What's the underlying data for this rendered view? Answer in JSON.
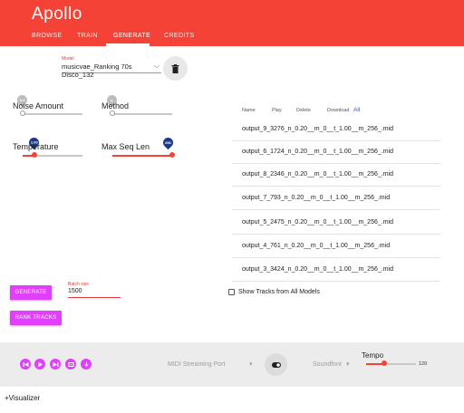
{
  "app": {
    "title": "Apollo"
  },
  "tabs": [
    {
      "label": "BROWSE"
    },
    {
      "label": "TRAIN"
    },
    {
      "label": "GENERATE"
    },
    {
      "label": "CREDITS"
    }
  ],
  "model": {
    "label": "Model",
    "value": "musicvae_Ranking 70s Disco_132"
  },
  "params": {
    "noise_amount": {
      "label": "Noise Amount",
      "value": "0.2"
    },
    "method": {
      "label": "Method",
      "value": "0"
    },
    "temperature": {
      "label": "Temperature",
      "value": "1.00"
    },
    "max_seq_len": {
      "label": "Max Seq Len",
      "value": "256"
    }
  },
  "tracks_table": {
    "headers": {
      "name": "Name",
      "play": "Play",
      "delete": "Delete",
      "download": "Download",
      "all": "All"
    },
    "rows": [
      "output_9_3276_n_0.20__m_0__t_1.00__m_256_.mid",
      "output_6_1724_n_0.20__m_0__t_1.00__m_256_.mid",
      "output_8_2346_n_0.20__m_0__t_1.00__m_256_.mid",
      "output_7_793_n_0.20__m_0__t_1.00__m_256_.mid",
      "output_5_2475_n_0.20__m_0__t_1.00__m_256_.mid",
      "output_4_761_n_0.20__m_0__t_1.00__m_256_.mid",
      "output_3_3424_n_0.20__m_0__t_1.00__m_256_.mid"
    ]
  },
  "generate": {
    "button_label": "GENERATE",
    "batch_label": "Batch size",
    "batch_value": "1500"
  },
  "rank": {
    "button_label": "RANK TRACKS"
  },
  "show_all": {
    "label": "Show Tracks from All Models",
    "checked": false
  },
  "player": {
    "controls": [
      "skip-previous-icon",
      "play-icon",
      "skip-next-icon",
      "loop-icon",
      "download-icon"
    ],
    "midi_port": "MIDI Streaming Port",
    "soundfont": "Soundfont",
    "tempo_label": "Tempo",
    "tempo_value": "120"
  },
  "visualizer": {
    "label": "+Visualizer"
  },
  "colors": {
    "primary": "#f44336",
    "accent": "#e040fb",
    "link": "#3f51b5",
    "pin": "#1a3a8c"
  }
}
